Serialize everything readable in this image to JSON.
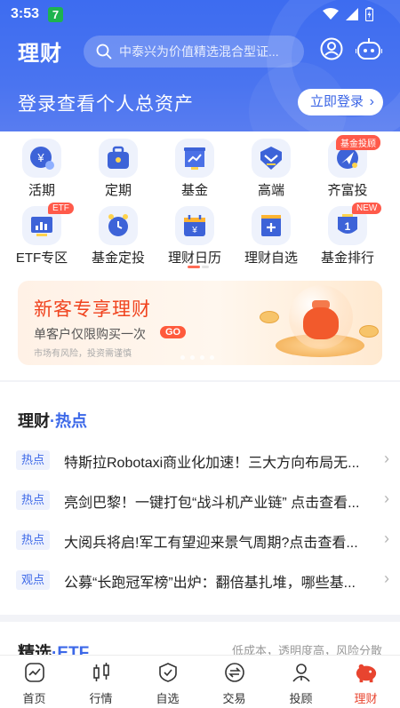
{
  "status_bar": {
    "time": "3:53",
    "app_badge": "7"
  },
  "header": {
    "title": "理财",
    "search_placeholder": "中泰兴为价值精选混合型证...",
    "login_prompt": "登录查看个人总资产",
    "login_button": "立即登录"
  },
  "quick_menu": [
    {
      "label": "活期",
      "icon": "yuan-coin-icon",
      "tag": ""
    },
    {
      "label": "定期",
      "icon": "briefcase-icon",
      "tag": ""
    },
    {
      "label": "基金",
      "icon": "fund-chart-icon",
      "tag": ""
    },
    {
      "label": "高端",
      "icon": "premium-badge-icon",
      "tag": ""
    },
    {
      "label": "齐富投",
      "icon": "plane-icon",
      "tag": "基金投顾"
    },
    {
      "label": "ETF专区",
      "icon": "etf-bars-icon",
      "tag": "ETF"
    },
    {
      "label": "基金定投",
      "icon": "clock-icon",
      "tag": ""
    },
    {
      "label": "理财日历",
      "icon": "calendar-icon",
      "tag": ""
    },
    {
      "label": "理财自选",
      "icon": "add-watch-icon",
      "tag": ""
    },
    {
      "label": "基金排行",
      "icon": "ranking-medal-icon",
      "tag": "NEW"
    }
  ],
  "promo_banner": {
    "title": "新客专享理财",
    "subtitle": "单客户仅限购买一次",
    "go_label": "GO",
    "risk_note": "市场有风险，投资需谨慎"
  },
  "hot_section": {
    "title_main": "理财",
    "title_accent": "·热点",
    "items": [
      {
        "badge": "热点",
        "text": "特斯拉Robotaxi商业化加速！三大方向布局无..."
      },
      {
        "badge": "热点",
        "text": "亮剑巴黎！一键打包“战斗机产业链” 点击查看..."
      },
      {
        "badge": "热点",
        "text": "大阅兵将启!军工有望迎来景气周期?点击查看..."
      },
      {
        "badge": "观点",
        "text": "公募“长跑冠军榜”出炉：翻倍基扎堆，哪些基..."
      }
    ]
  },
  "etf_section": {
    "title_main": "精选",
    "title_accent": "·ETF",
    "subtitle": "低成本，透明度高，风险分散"
  },
  "bottom_nav": [
    {
      "label": "首页",
      "icon": "home-chart-icon",
      "active": false
    },
    {
      "label": "行情",
      "icon": "candlestick-icon",
      "active": false
    },
    {
      "label": "自选",
      "icon": "check-shield-icon",
      "active": false
    },
    {
      "label": "交易",
      "icon": "exchange-icon",
      "active": false
    },
    {
      "label": "投顾",
      "icon": "advisor-icon",
      "active": false
    },
    {
      "label": "理财",
      "icon": "piggy-bank-icon",
      "active": true
    }
  ],
  "colors": {
    "brand_blue": "#3d6cf0",
    "accent_red": "#e8442f",
    "promo_orange": "#f0431e"
  }
}
